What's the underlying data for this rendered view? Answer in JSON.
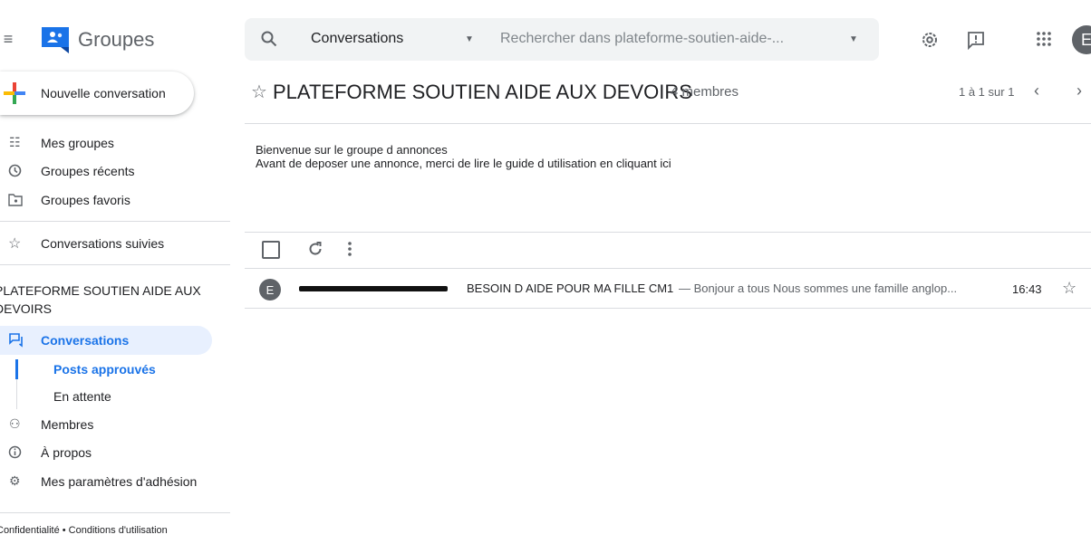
{
  "app": {
    "name": "Groupes"
  },
  "search": {
    "scope": "Conversations",
    "placeholder": "Rechercher dans plateforme-soutien-aide-..."
  },
  "user": {
    "avatar_letter": "E"
  },
  "sidebar": {
    "compose_label": "Nouvelle conversation",
    "items": [
      {
        "label": "Mes groupes",
        "icon": "groups-icon"
      },
      {
        "label": "Groupes récents",
        "icon": "clock-icon"
      },
      {
        "label": "Groupes favoris",
        "icon": "star-folder-icon"
      },
      {
        "label": "Conversations suivies",
        "icon": "star-outline-icon"
      }
    ],
    "group_name": "PLATEFORME SOUTIEN AIDE AUX DEVOIRS",
    "group_nav": {
      "conversations": "Conversations",
      "posts_approved": "Posts approuvés",
      "pending": "En attente",
      "members": "Membres",
      "about": "À propos",
      "settings": "Mes paramètres d'adhésion"
    },
    "footer": "Confidentialité • Conditions d'utilisation"
  },
  "main": {
    "title": "PLATEFORME SOUTIEN AIDE AUX DEVOIRS",
    "members_count": "4 membres",
    "pagination": "1 à 1 sur 1",
    "description_line1": "Bienvenue sur le groupe d annonces",
    "description_line2": "Avant de deposer une annonce, merci de lire le guide d utilisation en cliquant ici",
    "conversations": [
      {
        "avatar_letter": "E",
        "subject": "BESOIN D AIDE POUR MA FILLE CM1",
        "snippet": " — Bonjour a tous Nous sommes une famille anglop...",
        "time": "16:43"
      }
    ]
  },
  "colors": {
    "accent": "#1a73e8",
    "active_bg": "#e8f0fe",
    "search_bg": "#f1f3f4"
  }
}
